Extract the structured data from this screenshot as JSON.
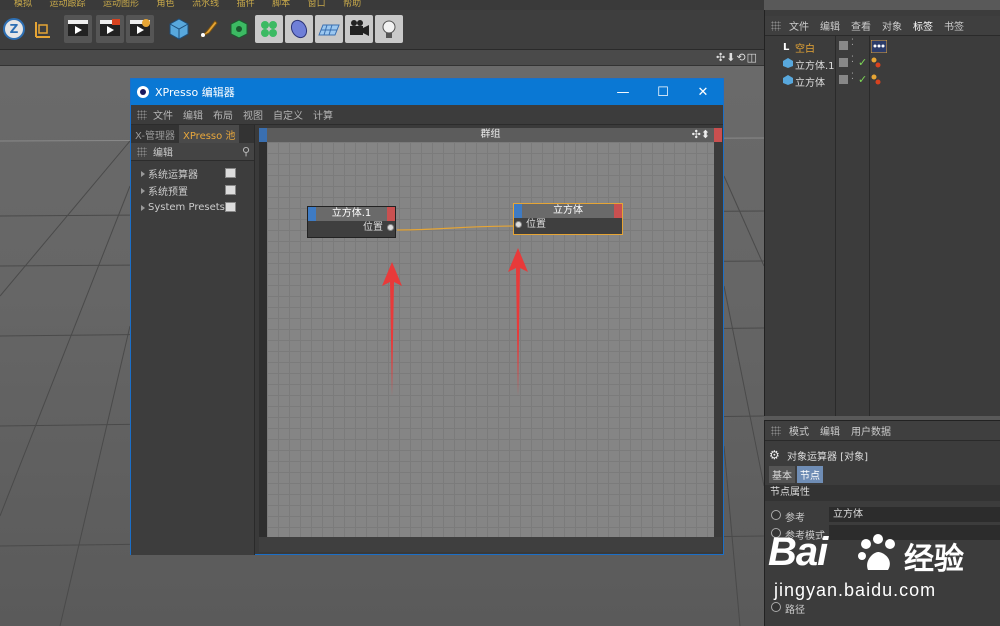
{
  "menubar": {
    "items": [
      "模拟",
      "运动跟踪",
      "运动图形",
      "角色",
      "流水线",
      "插件",
      "脚本",
      "窗口",
      "帮助"
    ]
  },
  "toolbar": {
    "icons": [
      "zbrush-icon",
      "axis-icon",
      "render-view-icon",
      "render-picture-icon",
      "render-settings-icon",
      "cube-icon",
      "pen-icon",
      "subdivision-icon",
      "cloner-icon",
      "deformer-icon",
      "floor-icon",
      "camera-icon",
      "light-icon"
    ]
  },
  "viewport": {
    "nav_icons": "✣⬇⟲◫"
  },
  "xpresso": {
    "title": "XPresso 编辑器",
    "controls": {
      "minimize": "—",
      "maximize": "☐",
      "close": "✕"
    },
    "menu": [
      "文件",
      "编辑",
      "布局",
      "视图",
      "自定义",
      "计算"
    ],
    "tabs": [
      "X-管理器",
      "XPresso 池"
    ],
    "active_tab": "XPresso 池",
    "pool_header": "编辑",
    "pool_items": [
      "系统运算器",
      "系统预置",
      "System Presets"
    ],
    "group_title": "群组",
    "nodes": [
      {
        "title": "立方体.1",
        "port": "位置",
        "selected": false
      },
      {
        "title": "立方体",
        "port": "位置",
        "selected": true
      }
    ],
    "wire_color": "#e6a535",
    "arrow_color": "#e83a3a"
  },
  "object_manager": {
    "menu": [
      "文件",
      "编辑",
      "查看",
      "对象",
      "标签",
      "书签"
    ],
    "active": "标签",
    "objects": [
      {
        "name": "空白",
        "icon": "null-icon",
        "color": "#e6a535"
      },
      {
        "name": "立方体.1",
        "icon": "cube-icon",
        "color": "#dddddd"
      },
      {
        "name": "立方体",
        "icon": "cube-icon",
        "color": "#dddddd"
      }
    ]
  },
  "attributes": {
    "menu": [
      "模式",
      "编辑",
      "用户数据"
    ],
    "title": "对象运算器 [对象]",
    "tabs": [
      "基本",
      "节点"
    ],
    "active_tab": "节点",
    "section": "节点属性",
    "rows": [
      {
        "label": "参考",
        "value": "立方体"
      },
      {
        "label": "参考模式",
        "value": ""
      },
      {
        "label": "路径",
        "value": ""
      }
    ]
  },
  "watermark": {
    "brand": "Bai",
    "brand2": "经验",
    "url": "jingyan.baidu.com"
  }
}
